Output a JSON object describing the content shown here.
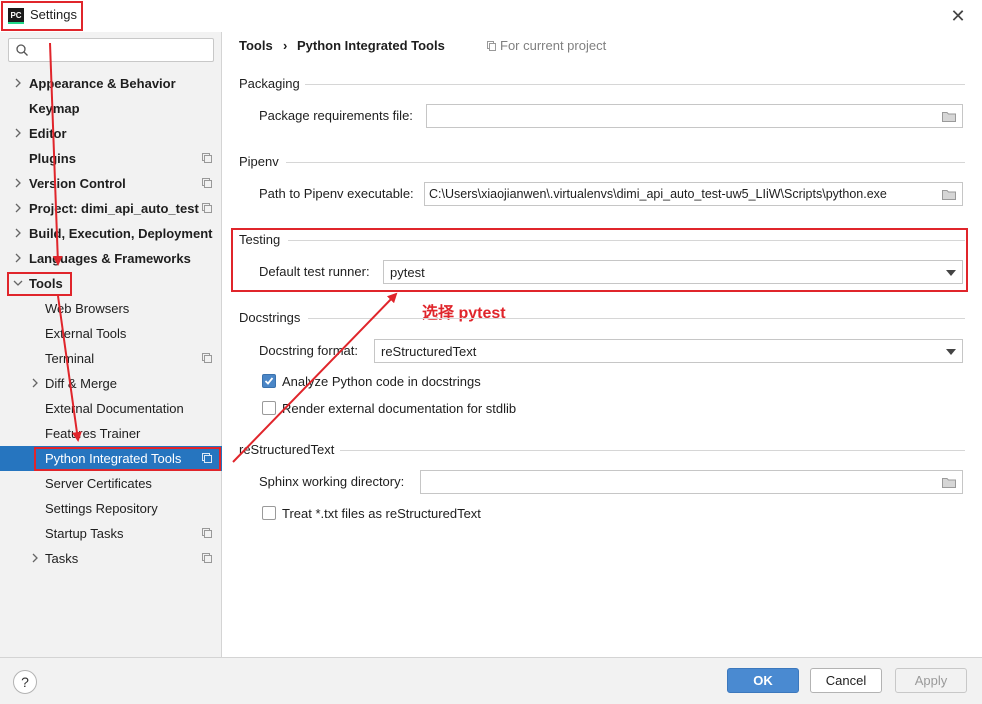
{
  "window": {
    "title": "Settings",
    "logo_text": "PC"
  },
  "search": {
    "placeholder": ""
  },
  "sidebar": {
    "items": [
      {
        "label": "Appearance & Behavior"
      },
      {
        "label": "Keymap"
      },
      {
        "label": "Editor"
      },
      {
        "label": "Plugins"
      },
      {
        "label": "Version Control"
      },
      {
        "label": "Project: dimi_api_auto_test"
      },
      {
        "label": "Build, Execution, Deployment"
      },
      {
        "label": "Languages & Frameworks"
      },
      {
        "label": "Tools"
      },
      {
        "label": "Web Browsers"
      },
      {
        "label": "External Tools"
      },
      {
        "label": "Terminal"
      },
      {
        "label": "Diff & Merge"
      },
      {
        "label": "External Documentation"
      },
      {
        "label": "Features Trainer"
      },
      {
        "label": "Python Integrated Tools"
      },
      {
        "label": "Server Certificates"
      },
      {
        "label": "Settings Repository"
      },
      {
        "label": "Startup Tasks"
      },
      {
        "label": "Tasks"
      }
    ]
  },
  "header": {
    "crumb_parent": "Tools",
    "crumb_separator": "›",
    "crumb_current": "Python Integrated Tools",
    "scope": "For current project"
  },
  "packaging": {
    "title": "Packaging",
    "req_label": "Package requirements file:",
    "req_value": ""
  },
  "pipenv": {
    "title": "Pipenv",
    "path_label": "Path to Pipenv executable:",
    "path_value": "C:\\Users\\xiaojianwen\\.virtualenvs\\dimi_api_auto_test-uw5_LIiW\\Scripts\\python.exe"
  },
  "testing": {
    "title": "Testing",
    "runner_label": "Default test runner:",
    "runner_value": "pytest"
  },
  "annotation": {
    "text": "选择 pytest"
  },
  "docstrings": {
    "title": "Docstrings",
    "format_label": "Docstring format:",
    "format_value": "reStructuredText",
    "analyze_label": "Analyze Python code in docstrings",
    "analyze_checked": true,
    "render_label": "Render external documentation for stdlib",
    "render_checked": false
  },
  "rest": {
    "title": "reStructuredText",
    "sphinx_label": "Sphinx working directory:",
    "sphinx_value": "",
    "treat_label": "Treat *.txt files as reStructuredText",
    "treat_checked": false
  },
  "buttons": {
    "help": "?",
    "ok": "OK",
    "cancel": "Cancel",
    "apply": "Apply"
  },
  "colors": {
    "accent": "#2675bf",
    "annotation": "#e0252b",
    "ok_button": "#4a8ad1"
  }
}
